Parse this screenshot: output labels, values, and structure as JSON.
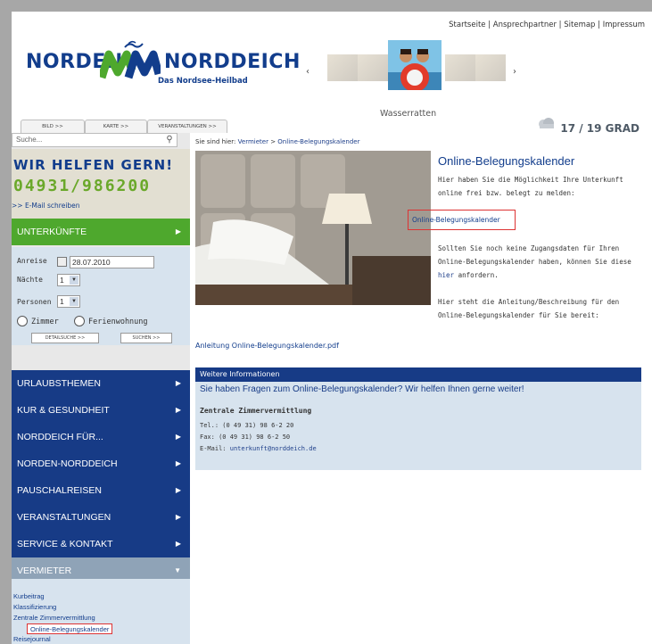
{
  "header": {
    "nav": [
      "Startseite",
      "Ansprechpartner",
      "Sitemap",
      "Impressum"
    ],
    "separator": " | ",
    "logo": {
      "left": "NORDEN",
      "right": "NORDDEICH",
      "tagline": "Das Nordsee-Heilbad",
      "mark_color": "#4ea82d",
      "text_color": "#123d8c"
    },
    "carousel_caption": "Wasserratten",
    "weather": "17 / 19 GRAD"
  },
  "tabs": [
    "BILD >>",
    "KARTE >>",
    "VERANSTALTUNGEN >>"
  ],
  "sidebar": {
    "search_placeholder": "Suche...",
    "help": {
      "title": "WIR HELFEN GERN!",
      "phone": "04931/986200",
      "mail": ">> E-Mail schreiben"
    },
    "unterkuenfte": "UNTERKÜNFTE",
    "booking": {
      "anreise_label": "Anreise",
      "anreise_value": "28.07.2010",
      "naechte_label": "Nächte",
      "naechte_value": "1",
      "personen_label": "Personen",
      "personen_value": "1",
      "zimmer": "Zimmer",
      "ferienwohnung": "Ferienwohnung",
      "detail_btn": "DETAILSUCHE >>",
      "search_btn": "SUCHEN >>"
    },
    "menu": [
      "URLAUBSTHEMEN",
      "KUR & GESUNDHEIT",
      "NORDDEICH FÜR...",
      "NORDEN-NORDDEICH",
      "PAUSCHALREISEN",
      "VERANSTALTUNGEN",
      "SERVICE & KONTAKT"
    ],
    "vermieter": "VERMIETER",
    "submenu": [
      "Kurbeitrag",
      "Klassifizierung",
      "Zentrale Zimmervermittlung",
      "Online-Belegungskalender",
      "Reisejournal"
    ]
  },
  "main": {
    "crumb_prefix": "Sie sind hier:",
    "crumb_1": "Vermieter",
    "crumb_sep": " > ",
    "crumb_2": "Online-Belegungskalender",
    "title": "Online-Belegungskalender",
    "p1": "Hier haben Sie die Möglichkeit Ihre Unterkunft online frei bzw. belegt zu melden:",
    "cal_link": "Online-Belegungskalender",
    "p2_a": "Sollten Sie noch keine Zugangsdaten für Ihren Online-Belegungskalender haben, können Sie diese",
    "p2_link": "hier",
    "p2_b": "anfordern.",
    "p3": "Hier steht die Anleitung/Beschreibung für den Online-Belegungskalender für Sie bereit:",
    "pdf": "Anleitung Online-Belegungskalender.pdf",
    "info_head": "Weitere Informationen",
    "info_q": "Sie haben Fragen zum Online-Belegungskalender? Wir helfen Ihnen gerne weiter!",
    "info_zv": "Zentrale Zimmervermittlung",
    "tel": "Tel.: (0 49 31) 98 6-2 20",
    "fax": "Fax: (0 49 31) 98 6-2 50",
    "email_label": "E-Mail:",
    "email": "unterkunft@norddeich.de"
  },
  "colors": {
    "navy": "#173b86",
    "green": "#4ea82d",
    "light_blue": "#d7e3ee",
    "highlight": "#dd3333"
  }
}
